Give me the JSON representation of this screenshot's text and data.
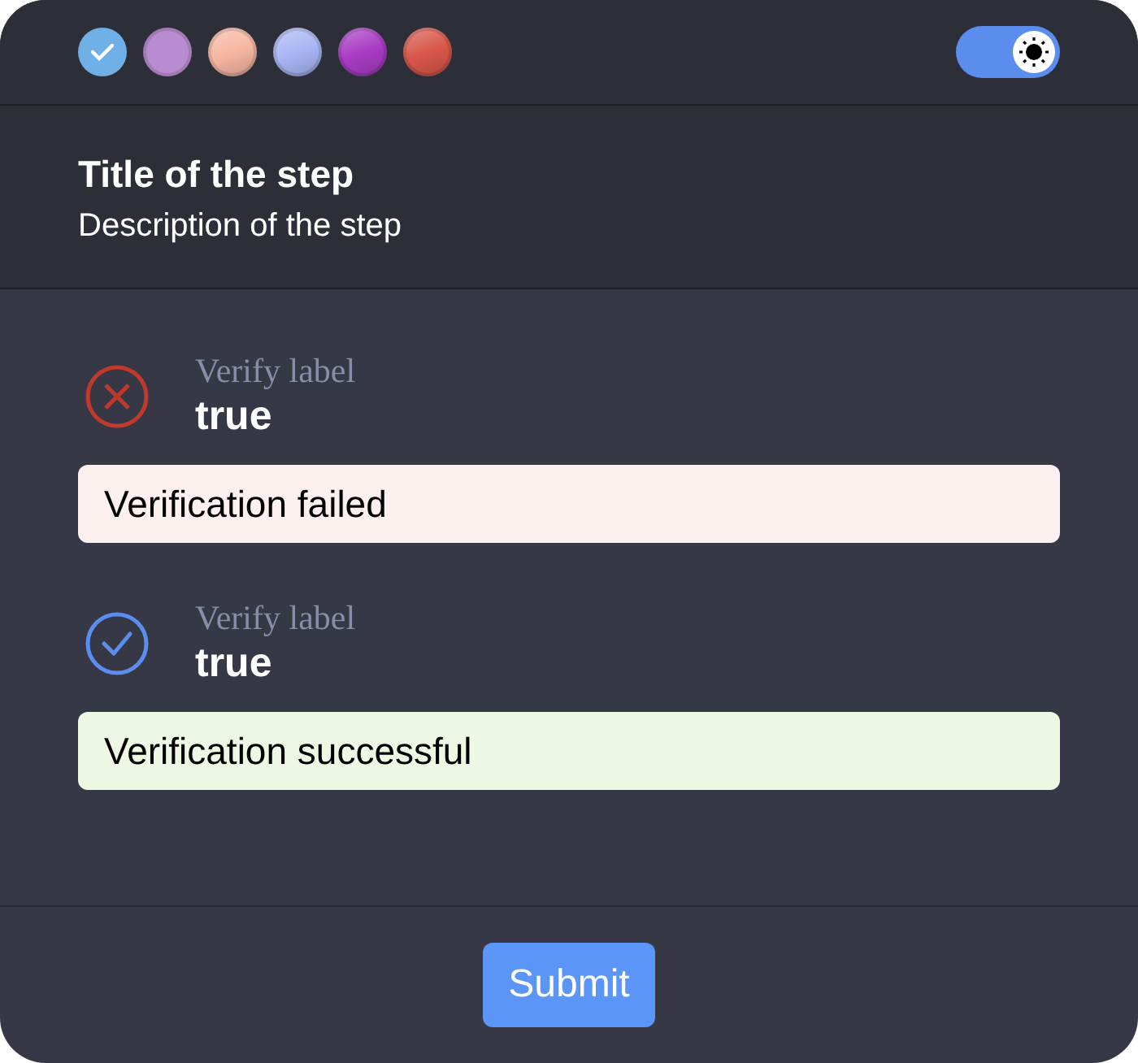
{
  "theme_swatches": [
    {
      "kind": "solid",
      "color": "#6fb1e6",
      "selected": true
    },
    {
      "kind": "solid",
      "color": "#b98bd0",
      "selected": false
    },
    {
      "kind": "gradient",
      "color": "#f6b7a2",
      "selected": false
    },
    {
      "kind": "gradient",
      "color": "#a9b6f4",
      "selected": false
    },
    {
      "kind": "gradient",
      "color": "#a93cc4",
      "selected": false
    },
    {
      "kind": "gradient",
      "color": "#d9574a",
      "selected": false
    }
  ],
  "theme_toggle": {
    "on": true
  },
  "step": {
    "title": "Title of the step",
    "description": "Description of the step"
  },
  "verifications": [
    {
      "label": "Verify label",
      "value": "true",
      "kind": "failed",
      "message": "Verification failed"
    },
    {
      "label": "Verify label",
      "value": "true",
      "kind": "success",
      "message": "Verification successful"
    }
  ],
  "submit": "Submit"
}
